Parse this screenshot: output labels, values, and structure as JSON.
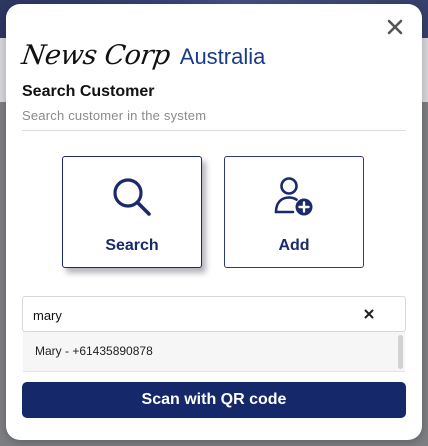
{
  "brand": {
    "script_text": "News Corp",
    "word_text": "Australia",
    "accent_color": "#15286a"
  },
  "dialog": {
    "title": "Search Customer",
    "subtitle": "Search customer in the system",
    "close_icon": "close-icon"
  },
  "options": [
    {
      "label": "Search",
      "icon": "search-icon",
      "active": true
    },
    {
      "label": "Add",
      "icon": "add-user-icon",
      "active": false
    }
  ],
  "search": {
    "value": "mary",
    "clear_icon": "clear-icon"
  },
  "results": [
    {
      "label": "Mary - +61435890878"
    }
  ],
  "actions": {
    "qr_label": "Scan with QR code"
  }
}
